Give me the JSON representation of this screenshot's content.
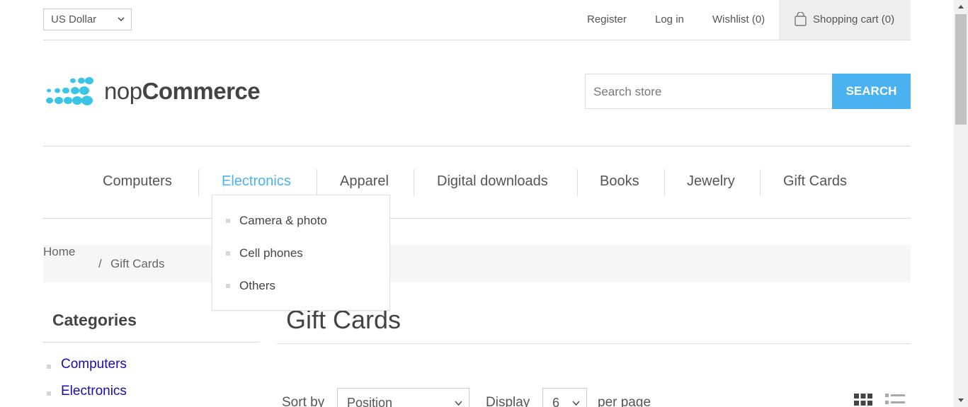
{
  "header": {
    "currency": "US Dollar",
    "links": {
      "register": "Register",
      "login": "Log in",
      "wishlist": "Wishlist (0)",
      "cart": "Shopping cart (0)"
    }
  },
  "logo": {
    "light": "nop",
    "bold": "Commerce"
  },
  "search": {
    "placeholder": "Search store",
    "button": "Search"
  },
  "nav": {
    "items": [
      "Computers",
      "Electronics",
      "Apparel",
      "Digital downloads",
      "Books",
      "Jewelry",
      "Gift Cards"
    ],
    "active": "Electronics"
  },
  "dropdown": {
    "items": [
      "Camera & photo",
      "Cell phones",
      "Others"
    ]
  },
  "breadcrumb": {
    "home": "Home",
    "separator": "/",
    "current": "Gift Cards"
  },
  "side": {
    "title": "Categories",
    "items": [
      "Computers",
      "Electronics"
    ]
  },
  "main": {
    "title": "Gift Cards",
    "sort_label": "Sort by",
    "sort_value": "Position",
    "display_label": "Display",
    "display_value": "6",
    "per_page": "per page"
  },
  "colors": {
    "accent": "#4ab2f1",
    "link": "#1a0dab",
    "logo_dots": "#3ac4e6"
  }
}
